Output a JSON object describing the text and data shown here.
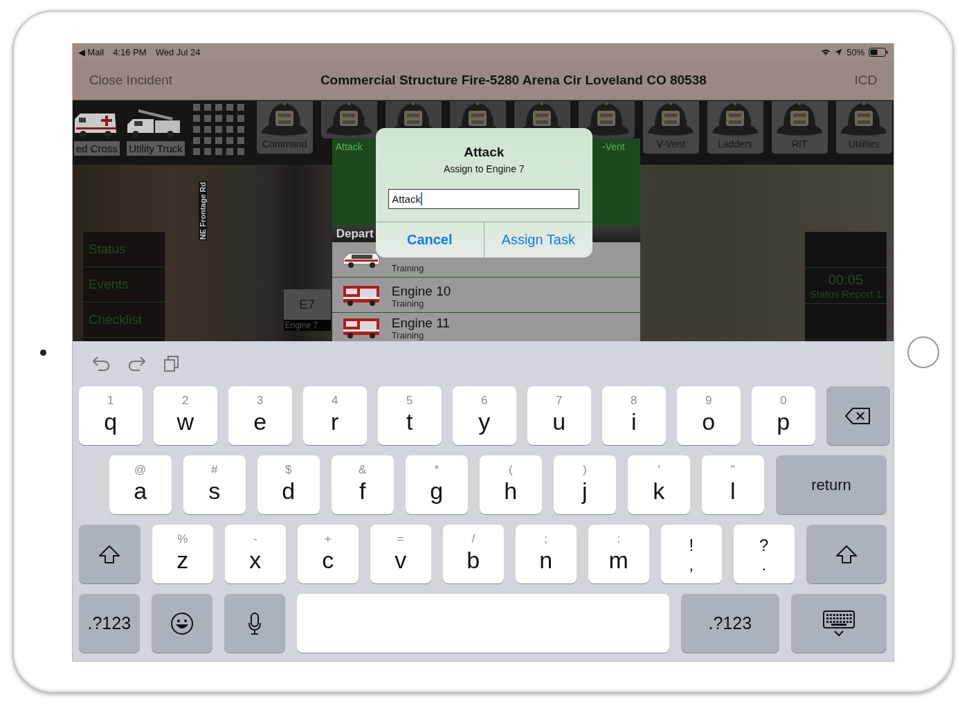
{
  "status_bar": {
    "back": "◀ Mail",
    "time": "4:16 PM",
    "date": "Wed Jul 24",
    "battery": "50%"
  },
  "nav_bar": {
    "left_button": {
      "label": "Close Incident",
      "disabled": true
    },
    "title": "Commercial Structure Fire-5280 Arena Cir Loveland CO 80538",
    "right_button": {
      "label": "ICD",
      "disabled": true
    }
  },
  "vehicle_tiles": [
    {
      "kind": "ambulance",
      "label": "ed Cross"
    },
    {
      "kind": "utility_truck",
      "label": "Utility Truck"
    }
  ],
  "task_tiles": [
    {
      "label": "Command",
      "covered": false
    },
    {
      "covered": true
    },
    {
      "covered": true
    },
    {
      "covered": true
    },
    {
      "covered": true
    },
    {
      "covered": true
    },
    {
      "label": "V-Vent",
      "covered": false
    },
    {
      "label": "Ladders",
      "covered": false
    },
    {
      "label": "RIT",
      "covered": false
    },
    {
      "label": "Utilities",
      "covered": false
    }
  ],
  "task_panel": {
    "labels": [
      "Attack",
      "-Vent"
    ]
  },
  "map": {
    "road_label": "NE Frontage Rd",
    "menu": [
      {
        "label": "Status"
      },
      {
        "label": "Events"
      },
      {
        "label": "Checklist"
      }
    ],
    "unit_marker": {
      "code": "E7",
      "name": "Engine 7"
    },
    "timer_panel": {
      "time": "00:05",
      "label": "Status Report 1"
    }
  },
  "department_list": {
    "header": "Depart",
    "units": [
      {
        "kind": "suv",
        "subtitle": "Training"
      },
      {
        "kind": "engine",
        "name": "Engine 10",
        "subtitle": "Training"
      },
      {
        "kind": "engine",
        "name": "Engine 11",
        "subtitle": "Training"
      }
    ]
  },
  "dialog": {
    "title": "Attack",
    "message": "Assign to Engine 7",
    "field_value": "Attack",
    "buttons": [
      {
        "label": "Cancel",
        "primary": true
      },
      {
        "label": "Assign Task",
        "primary": false
      }
    ]
  },
  "keyboard": {
    "rows": [
      [
        {
          "kind": "letter",
          "hint": "1",
          "char": "q"
        },
        {
          "kind": "letter",
          "hint": "2",
          "char": "w"
        },
        {
          "kind": "letter",
          "hint": "3",
          "char": "e"
        },
        {
          "kind": "letter",
          "hint": "4",
          "char": "r"
        },
        {
          "kind": "letter",
          "hint": "5",
          "char": "t"
        },
        {
          "kind": "letter",
          "hint": "6",
          "char": "y"
        },
        {
          "kind": "letter",
          "hint": "7",
          "char": "u"
        },
        {
          "kind": "letter",
          "hint": "8",
          "char": "i"
        },
        {
          "kind": "letter",
          "hint": "9",
          "char": "o"
        },
        {
          "kind": "letter",
          "hint": "0",
          "char": "p"
        },
        {
          "kind": "delete"
        }
      ],
      [
        {
          "kind": "letter",
          "hint": "@",
          "char": "a"
        },
        {
          "kind": "letter",
          "hint": "#",
          "char": "s"
        },
        {
          "kind": "letter",
          "hint": "$",
          "char": "d"
        },
        {
          "kind": "letter",
          "hint": "&",
          "char": "f"
        },
        {
          "kind": "letter",
          "hint": "*",
          "char": "g"
        },
        {
          "kind": "letter",
          "hint": "(",
          "char": "h"
        },
        {
          "kind": "letter",
          "hint": ")",
          "char": "j"
        },
        {
          "kind": "letter",
          "hint": "'",
          "char": "k"
        },
        {
          "kind": "letter",
          "hint": "\"",
          "char": "l"
        },
        {
          "kind": "return",
          "label": "return"
        }
      ],
      [
        {
          "kind": "shift"
        },
        {
          "kind": "letter",
          "hint": "%",
          "char": "z"
        },
        {
          "kind": "letter",
          "hint": "-",
          "char": "x"
        },
        {
          "kind": "letter",
          "hint": "+",
          "char": "c"
        },
        {
          "kind": "letter",
          "hint": "=",
          "char": "v"
        },
        {
          "kind": "letter",
          "hint": "/",
          "char": "b"
        },
        {
          "kind": "letter",
          "hint": ";",
          "char": "n"
        },
        {
          "kind": "letter",
          "hint": ":",
          "char": "m"
        },
        {
          "kind": "punct",
          "hint": "!",
          "char": ","
        },
        {
          "kind": "punct",
          "hint": "?",
          "char": "."
        },
        {
          "kind": "shift"
        }
      ],
      [
        {
          "kind": "mode",
          "label": ".?123"
        },
        {
          "kind": "emoji"
        },
        {
          "kind": "mic"
        },
        {
          "kind": "space"
        },
        {
          "kind": "mode",
          "label": ".?123"
        },
        {
          "kind": "dismiss"
        }
      ]
    ]
  }
}
